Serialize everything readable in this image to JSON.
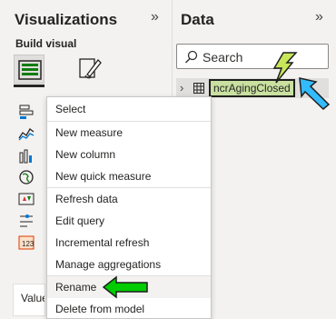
{
  "visualizations_pane": {
    "title": "Visualizations",
    "collapse_glyph": "»",
    "build_visual_label": "Build visual",
    "values_label": "Values",
    "icons": [
      "stacked-bar-chart-icon",
      "line-chart-icon",
      "column-chart-icon",
      "map-icon",
      "kpi-icon",
      "slicer-icon",
      "table-visual-icon"
    ]
  },
  "data_pane": {
    "title": "Data",
    "collapse_glyph": "»",
    "search_placeholder": "Search",
    "table_name": "ncrAgingClosed"
  },
  "context_menu": {
    "items": [
      "Select",
      "New measure",
      "New column",
      "New quick measure",
      "Refresh data",
      "Edit query",
      "Incremental refresh",
      "Manage aggregations",
      "Rename",
      "Delete from model"
    ],
    "highlighted": "Rename"
  },
  "annotations": {
    "arrow_left_color": "#00cc00",
    "arrow_diag_color": "#00aaff",
    "lightning_color": "#c8e65a"
  }
}
